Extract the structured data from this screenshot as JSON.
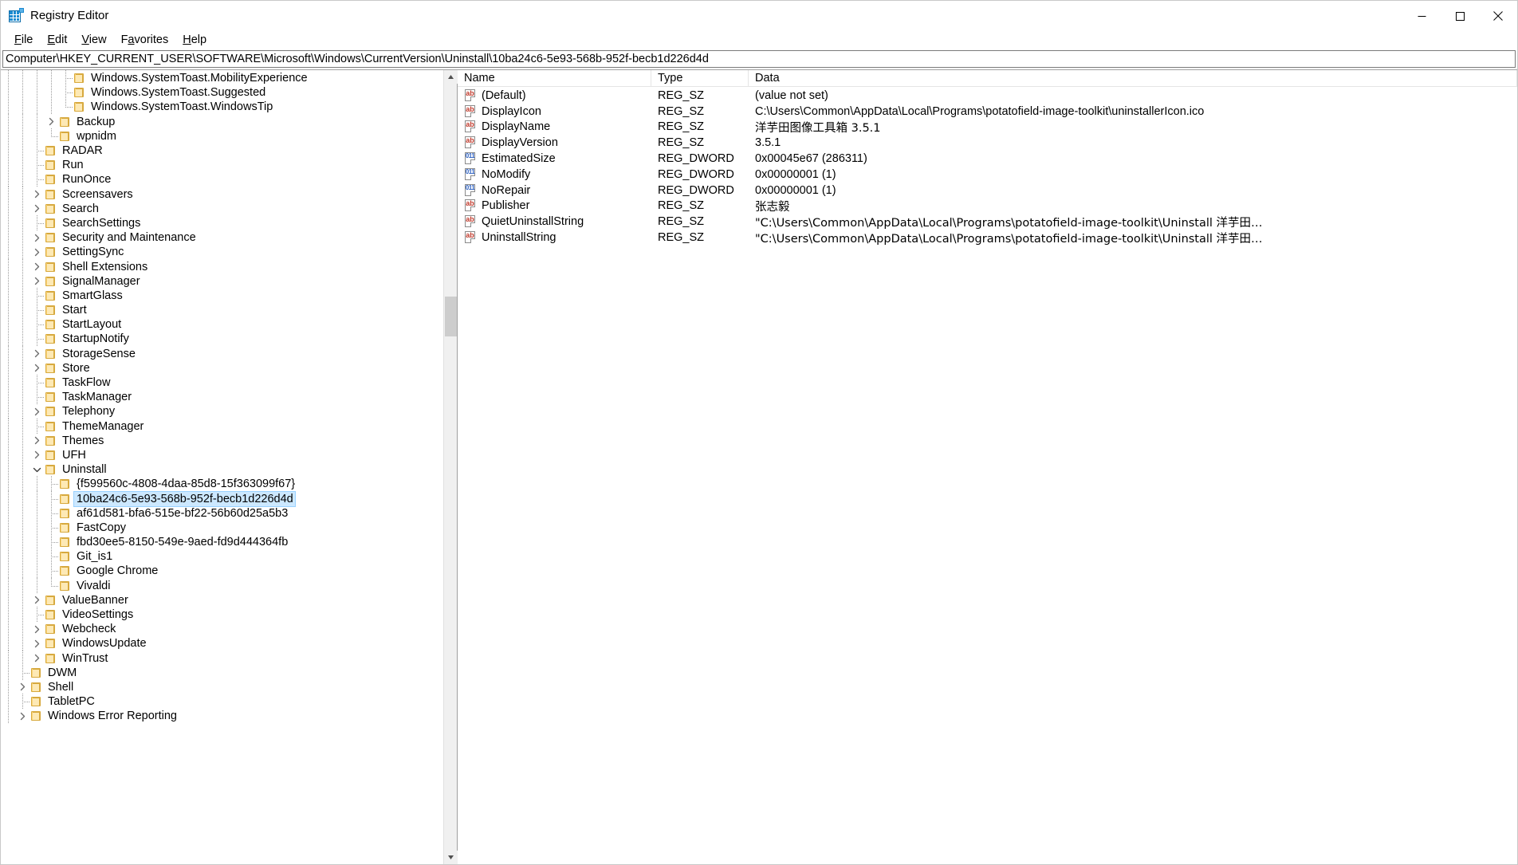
{
  "window": {
    "title": "Registry Editor",
    "icon": "registry-icon",
    "minimize_label": "Minimize",
    "maximize_label": "Maximize",
    "close_label": "Close"
  },
  "menu": {
    "items": [
      {
        "label": "File",
        "mnemonic": "F"
      },
      {
        "label": "Edit",
        "mnemonic": "E"
      },
      {
        "label": "View",
        "mnemonic": "V"
      },
      {
        "label": "Favorites",
        "mnemonic": "a"
      },
      {
        "label": "Help",
        "mnemonic": "H"
      }
    ]
  },
  "address": {
    "path": "Computer\\HKEY_CURRENT_USER\\SOFTWARE\\Microsoft\\Windows\\CurrentVersion\\Uninstall\\10ba24c6-5e93-568b-952f-becb1d226d4d"
  },
  "tree": {
    "nodes": [
      {
        "label": "Windows.SystemToast.MobilityExperience",
        "depth": 5,
        "expander": "none",
        "connector": "tee",
        "selected": false
      },
      {
        "label": "Windows.SystemToast.Suggested",
        "depth": 5,
        "expander": "none",
        "connector": "tee",
        "selected": false
      },
      {
        "label": "Windows.SystemToast.WindowsTip",
        "depth": 5,
        "expander": "none",
        "connector": "ell",
        "selected": false
      },
      {
        "label": "Backup",
        "depth": 4,
        "expander": "collapsed",
        "connector": "none",
        "selected": false
      },
      {
        "label": "wpnidm",
        "depth": 4,
        "expander": "none",
        "connector": "ell",
        "selected": false
      },
      {
        "label": "RADAR",
        "depth": 3,
        "expander": "none",
        "connector": "tee",
        "selected": false
      },
      {
        "label": "Run",
        "depth": 3,
        "expander": "none",
        "connector": "tee",
        "selected": false
      },
      {
        "label": "RunOnce",
        "depth": 3,
        "expander": "none",
        "connector": "tee",
        "selected": false
      },
      {
        "label": "Screensavers",
        "depth": 3,
        "expander": "collapsed",
        "connector": "none",
        "selected": false
      },
      {
        "label": "Search",
        "depth": 3,
        "expander": "collapsed",
        "connector": "none",
        "selected": false
      },
      {
        "label": "SearchSettings",
        "depth": 3,
        "expander": "none",
        "connector": "tee",
        "selected": false
      },
      {
        "label": "Security and Maintenance",
        "depth": 3,
        "expander": "collapsed",
        "connector": "none",
        "selected": false
      },
      {
        "label": "SettingSync",
        "depth": 3,
        "expander": "collapsed",
        "connector": "none",
        "selected": false
      },
      {
        "label": "Shell Extensions",
        "depth": 3,
        "expander": "collapsed",
        "connector": "none",
        "selected": false
      },
      {
        "label": "SignalManager",
        "depth": 3,
        "expander": "collapsed",
        "connector": "none",
        "selected": false
      },
      {
        "label": "SmartGlass",
        "depth": 3,
        "expander": "none",
        "connector": "tee",
        "selected": false
      },
      {
        "label": "Start",
        "depth": 3,
        "expander": "none",
        "connector": "tee",
        "selected": false
      },
      {
        "label": "StartLayout",
        "depth": 3,
        "expander": "none",
        "connector": "tee",
        "selected": false
      },
      {
        "label": "StartupNotify",
        "depth": 3,
        "expander": "none",
        "connector": "tee",
        "selected": false
      },
      {
        "label": "StorageSense",
        "depth": 3,
        "expander": "collapsed",
        "connector": "none",
        "selected": false
      },
      {
        "label": "Store",
        "depth": 3,
        "expander": "collapsed",
        "connector": "none",
        "selected": false
      },
      {
        "label": "TaskFlow",
        "depth": 3,
        "expander": "none",
        "connector": "tee",
        "selected": false
      },
      {
        "label": "TaskManager",
        "depth": 3,
        "expander": "none",
        "connector": "tee",
        "selected": false
      },
      {
        "label": "Telephony",
        "depth": 3,
        "expander": "collapsed",
        "connector": "none",
        "selected": false
      },
      {
        "label": "ThemeManager",
        "depth": 3,
        "expander": "none",
        "connector": "tee",
        "selected": false
      },
      {
        "label": "Themes",
        "depth": 3,
        "expander": "collapsed",
        "connector": "none",
        "selected": false
      },
      {
        "label": "UFH",
        "depth": 3,
        "expander": "collapsed",
        "connector": "none",
        "selected": false
      },
      {
        "label": "Uninstall",
        "depth": 3,
        "expander": "expanded",
        "connector": "none",
        "selected": false
      },
      {
        "label": "{f599560c-4808-4daa-85d8-15f363099f67}",
        "depth": 4,
        "expander": "none",
        "connector": "tee",
        "selected": false
      },
      {
        "label": "10ba24c6-5e93-568b-952f-becb1d226d4d",
        "depth": 4,
        "expander": "none",
        "connector": "tee",
        "selected": true
      },
      {
        "label": "af61d581-bfa6-515e-bf22-56b60d25a5b3",
        "depth": 4,
        "expander": "none",
        "connector": "tee",
        "selected": false
      },
      {
        "label": "FastCopy",
        "depth": 4,
        "expander": "none",
        "connector": "tee",
        "selected": false
      },
      {
        "label": "fbd30ee5-8150-549e-9aed-fd9d444364fb",
        "depth": 4,
        "expander": "none",
        "connector": "tee",
        "selected": false
      },
      {
        "label": "Git_is1",
        "depth": 4,
        "expander": "none",
        "connector": "tee",
        "selected": false
      },
      {
        "label": "Google Chrome",
        "depth": 4,
        "expander": "none",
        "connector": "tee",
        "selected": false
      },
      {
        "label": "Vivaldi",
        "depth": 4,
        "expander": "none",
        "connector": "ell",
        "selected": false
      },
      {
        "label": "ValueBanner",
        "depth": 3,
        "expander": "collapsed",
        "connector": "none",
        "selected": false
      },
      {
        "label": "VideoSettings",
        "depth": 3,
        "expander": "none",
        "connector": "tee",
        "selected": false
      },
      {
        "label": "Webcheck",
        "depth": 3,
        "expander": "collapsed",
        "connector": "none",
        "selected": false
      },
      {
        "label": "WindowsUpdate",
        "depth": 3,
        "expander": "collapsed",
        "connector": "none",
        "selected": false
      },
      {
        "label": "WinTrust",
        "depth": 3,
        "expander": "collapsed",
        "connector": "none",
        "selected": false
      },
      {
        "label": "DWM",
        "depth": 2,
        "expander": "none",
        "connector": "tee",
        "selected": false
      },
      {
        "label": "Shell",
        "depth": 2,
        "expander": "collapsed",
        "connector": "none",
        "selected": false
      },
      {
        "label": "TabletPC",
        "depth": 2,
        "expander": "none",
        "connector": "tee",
        "selected": false
      },
      {
        "label": "Windows Error Reporting",
        "depth": 2,
        "expander": "collapsed",
        "connector": "none",
        "selected": false
      }
    ]
  },
  "values": {
    "columns": [
      "Name",
      "Type",
      "Data"
    ],
    "rows": [
      {
        "name": "(Default)",
        "type": "REG_SZ",
        "data": "(value not set)",
        "icon": "string-value-icon"
      },
      {
        "name": "DisplayIcon",
        "type": "REG_SZ",
        "data": "C:\\Users\\Common\\AppData\\Local\\Programs\\potatofield-image-toolkit\\uninstallerIcon.ico",
        "icon": "string-value-icon"
      },
      {
        "name": "DisplayName",
        "type": "REG_SZ",
        "data": "洋芋田图像工具箱 3.5.1",
        "icon": "string-value-icon"
      },
      {
        "name": "DisplayVersion",
        "type": "REG_SZ",
        "data": "3.5.1",
        "icon": "string-value-icon"
      },
      {
        "name": "EstimatedSize",
        "type": "REG_DWORD",
        "data": "0x00045e67 (286311)",
        "icon": "dword-value-icon"
      },
      {
        "name": "NoModify",
        "type": "REG_DWORD",
        "data": "0x00000001 (1)",
        "icon": "dword-value-icon"
      },
      {
        "name": "NoRepair",
        "type": "REG_DWORD",
        "data": "0x00000001 (1)",
        "icon": "dword-value-icon"
      },
      {
        "name": "Publisher",
        "type": "REG_SZ",
        "data": "张志毅",
        "icon": "string-value-icon"
      },
      {
        "name": "QuietUninstallString",
        "type": "REG_SZ",
        "data": "\"C:\\Users\\Common\\AppData\\Local\\Programs\\potatofield-image-toolkit\\Uninstall 洋芋田…",
        "icon": "string-value-icon"
      },
      {
        "name": "UninstallString",
        "type": "REG_SZ",
        "data": "\"C:\\Users\\Common\\AppData\\Local\\Programs\\potatofield-image-toolkit\\Uninstall 洋芋田…",
        "icon": "string-value-icon"
      }
    ]
  },
  "colors": {
    "selection": "#cce8ff",
    "selection_border": "#99d1ff",
    "folder": "#fcd67b",
    "string_icon": "#c0392b",
    "dword_icon": "#2b5fc0"
  }
}
